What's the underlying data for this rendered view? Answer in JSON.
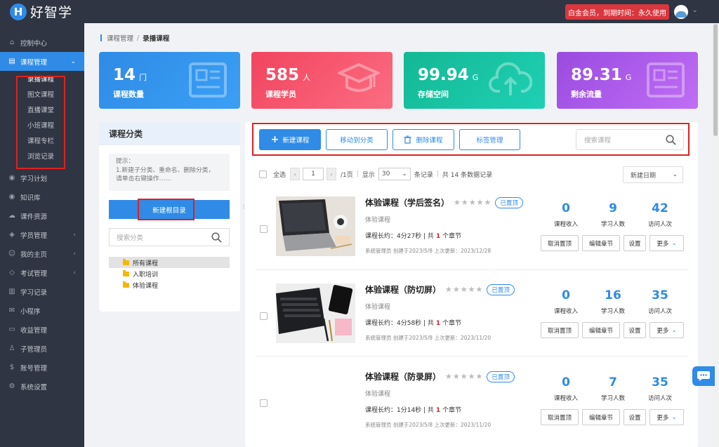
{
  "app": {
    "logo_letter": "H",
    "logo_text": "好智学",
    "vip_text": "白金会员，到期时间：永久使用"
  },
  "sidebar": {
    "items": [
      {
        "label": "控制中心",
        "icon": "home-icon",
        "glyph": "⌂"
      },
      {
        "label": "课程管理",
        "icon": "book-icon",
        "glyph": "▤",
        "active": true,
        "arrow": "⌄"
      },
      {
        "label": "学习计划",
        "icon": "eye-icon",
        "glyph": "◉"
      },
      {
        "label": "知识库",
        "icon": "eye-icon",
        "glyph": "◉"
      },
      {
        "label": "课件资源",
        "icon": "cloud-icon",
        "glyph": "☁"
      },
      {
        "label": "学员管理",
        "icon": "graduation-icon",
        "glyph": "◈",
        "arrow": "‹"
      },
      {
        "label": "我的主页",
        "icon": "user-icon",
        "glyph": "☺",
        "arrow": "‹"
      },
      {
        "label": "考试管理",
        "icon": "tag-icon",
        "glyph": "◇",
        "arrow": "‹"
      },
      {
        "label": "学习记录",
        "icon": "chart-icon",
        "glyph": "▥"
      },
      {
        "label": "小程序",
        "icon": "chat-icon",
        "glyph": "✉"
      },
      {
        "label": "收益管理",
        "icon": "wallet-icon",
        "glyph": "▭"
      },
      {
        "label": "子管理员",
        "icon": "person-icon",
        "glyph": "♙"
      },
      {
        "label": "账号管理",
        "icon": "dollar-icon",
        "glyph": "$"
      },
      {
        "label": "系统设置",
        "icon": "gear-icon",
        "glyph": "⚙"
      }
    ],
    "sub_items": [
      "录播课程",
      "图文课程",
      "直播课堂",
      "小班课程",
      "课程专栏",
      "浏览记录"
    ]
  },
  "breadcrumb": {
    "parent": "课程管理",
    "sep": "/",
    "current": "录播课程"
  },
  "stats": [
    {
      "value": "14",
      "unit": "门",
      "label": "课程数量",
      "color": "#2f8be6"
    },
    {
      "value": "585",
      "unit": "人",
      "label": "课程学员",
      "color": "#f04b6a"
    },
    {
      "value": "99.94",
      "unit": "G",
      "label": "存储空间",
      "color": "#17c3a3"
    },
    {
      "value": "89.31",
      "unit": "G",
      "label": "剩余流量",
      "color": "#a857e8"
    }
  ],
  "category": {
    "title": "课程分类",
    "tip_lines": [
      "提示：",
      "1.新建子分类、重命名、删除分类，",
      "请单击右键操作……"
    ],
    "new_root_label": "新建根目录",
    "search_placeholder": "搜索分类",
    "tree": [
      "所有课程",
      "入职培训",
      "体验课程"
    ]
  },
  "toolbar": {
    "new_course": "新建课程",
    "move_category": "移动到分类",
    "delete_course": "删除课程",
    "tag_manage": "标签管理",
    "search_placeholder": "搜索课程"
  },
  "pager": {
    "select_all": "全选",
    "page": "1",
    "pages_text": "/1页",
    "show_text": "显示",
    "per_page": "30",
    "records_text": "条记录",
    "total_text": "共 14 条数据记录",
    "sort_label": "新建日期"
  },
  "stat_labels": {
    "income": "课程收入",
    "learners": "学习人数",
    "visits": "访问人次"
  },
  "actions": {
    "unpin": "取消置顶",
    "edit_chapters": "编辑章节",
    "settings": "设置",
    "more": "更多"
  },
  "courses": [
    {
      "title": "体验课程（学后签名）",
      "tag": "已置顶",
      "subtitle": "体验课程",
      "duration_prefix": "课程长约：4分27秒 | 共",
      "chapters": "1",
      "chapter_suffix": "个章节",
      "meta": "系统管理员 创建于2023/5/8 上次更新：2023/12/28",
      "income": "0",
      "learners": "9",
      "visits": "42"
    },
    {
      "title": "体验课程（防切屏）",
      "tag": "已置顶",
      "subtitle": "体验课程",
      "duration_prefix": "课程长约：4分58秒 | 共",
      "chapters": "1",
      "chapter_suffix": "个章节",
      "meta": "系统管理员 创建于2023/5/8 上次更新：2023/11/20",
      "income": "0",
      "learners": "16",
      "visits": "35"
    },
    {
      "title": "体验课程（防录屏）",
      "tag": "已置顶",
      "subtitle": "体验课程",
      "duration_prefix": "课程长约：1分14秒 | 共",
      "chapters": "1",
      "chapter_suffix": "个章节",
      "meta": "系统管理员 创建于2023/5/8 上次更新：2023/11/20",
      "income": "0",
      "learners": "7",
      "visits": "35"
    }
  ]
}
